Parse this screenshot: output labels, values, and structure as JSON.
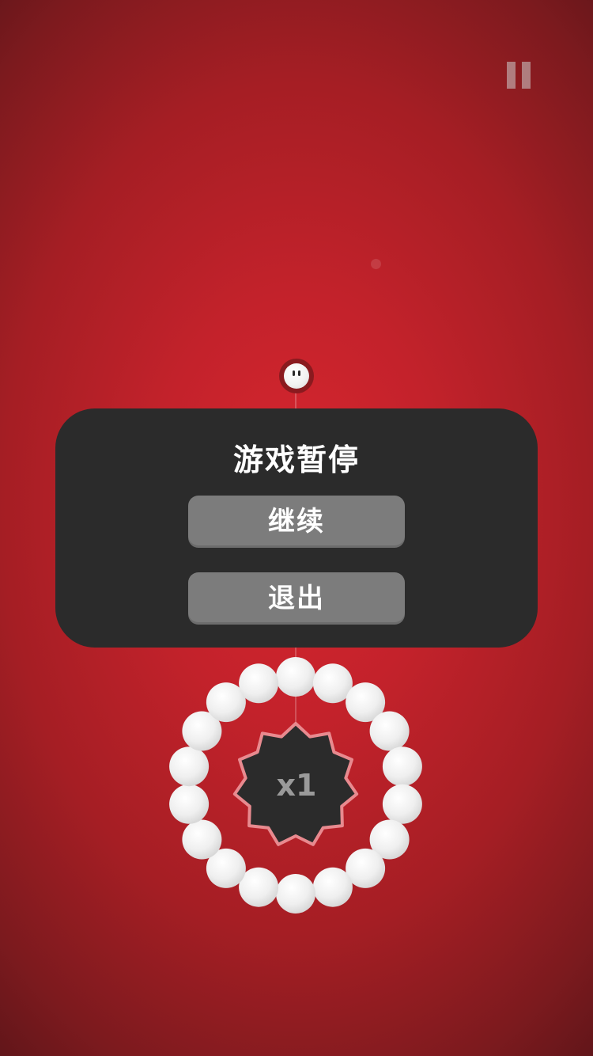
{
  "hud": {
    "pause_icon": "pause-icon"
  },
  "pause_dialog": {
    "title": "游戏暂停",
    "resume_label": "继续",
    "quit_label": "退出"
  },
  "target": {
    "multiplier": "x1",
    "remaining_balls": 18
  },
  "colors": {
    "background_center": "#d8262f",
    "background_edge": "#5e1519",
    "dialog": "#2b2b2b",
    "button": "#7c7c7c",
    "ball": "#f0f0f0",
    "target_body": "#2b2b2b",
    "target_rim": "#e88a8f"
  }
}
